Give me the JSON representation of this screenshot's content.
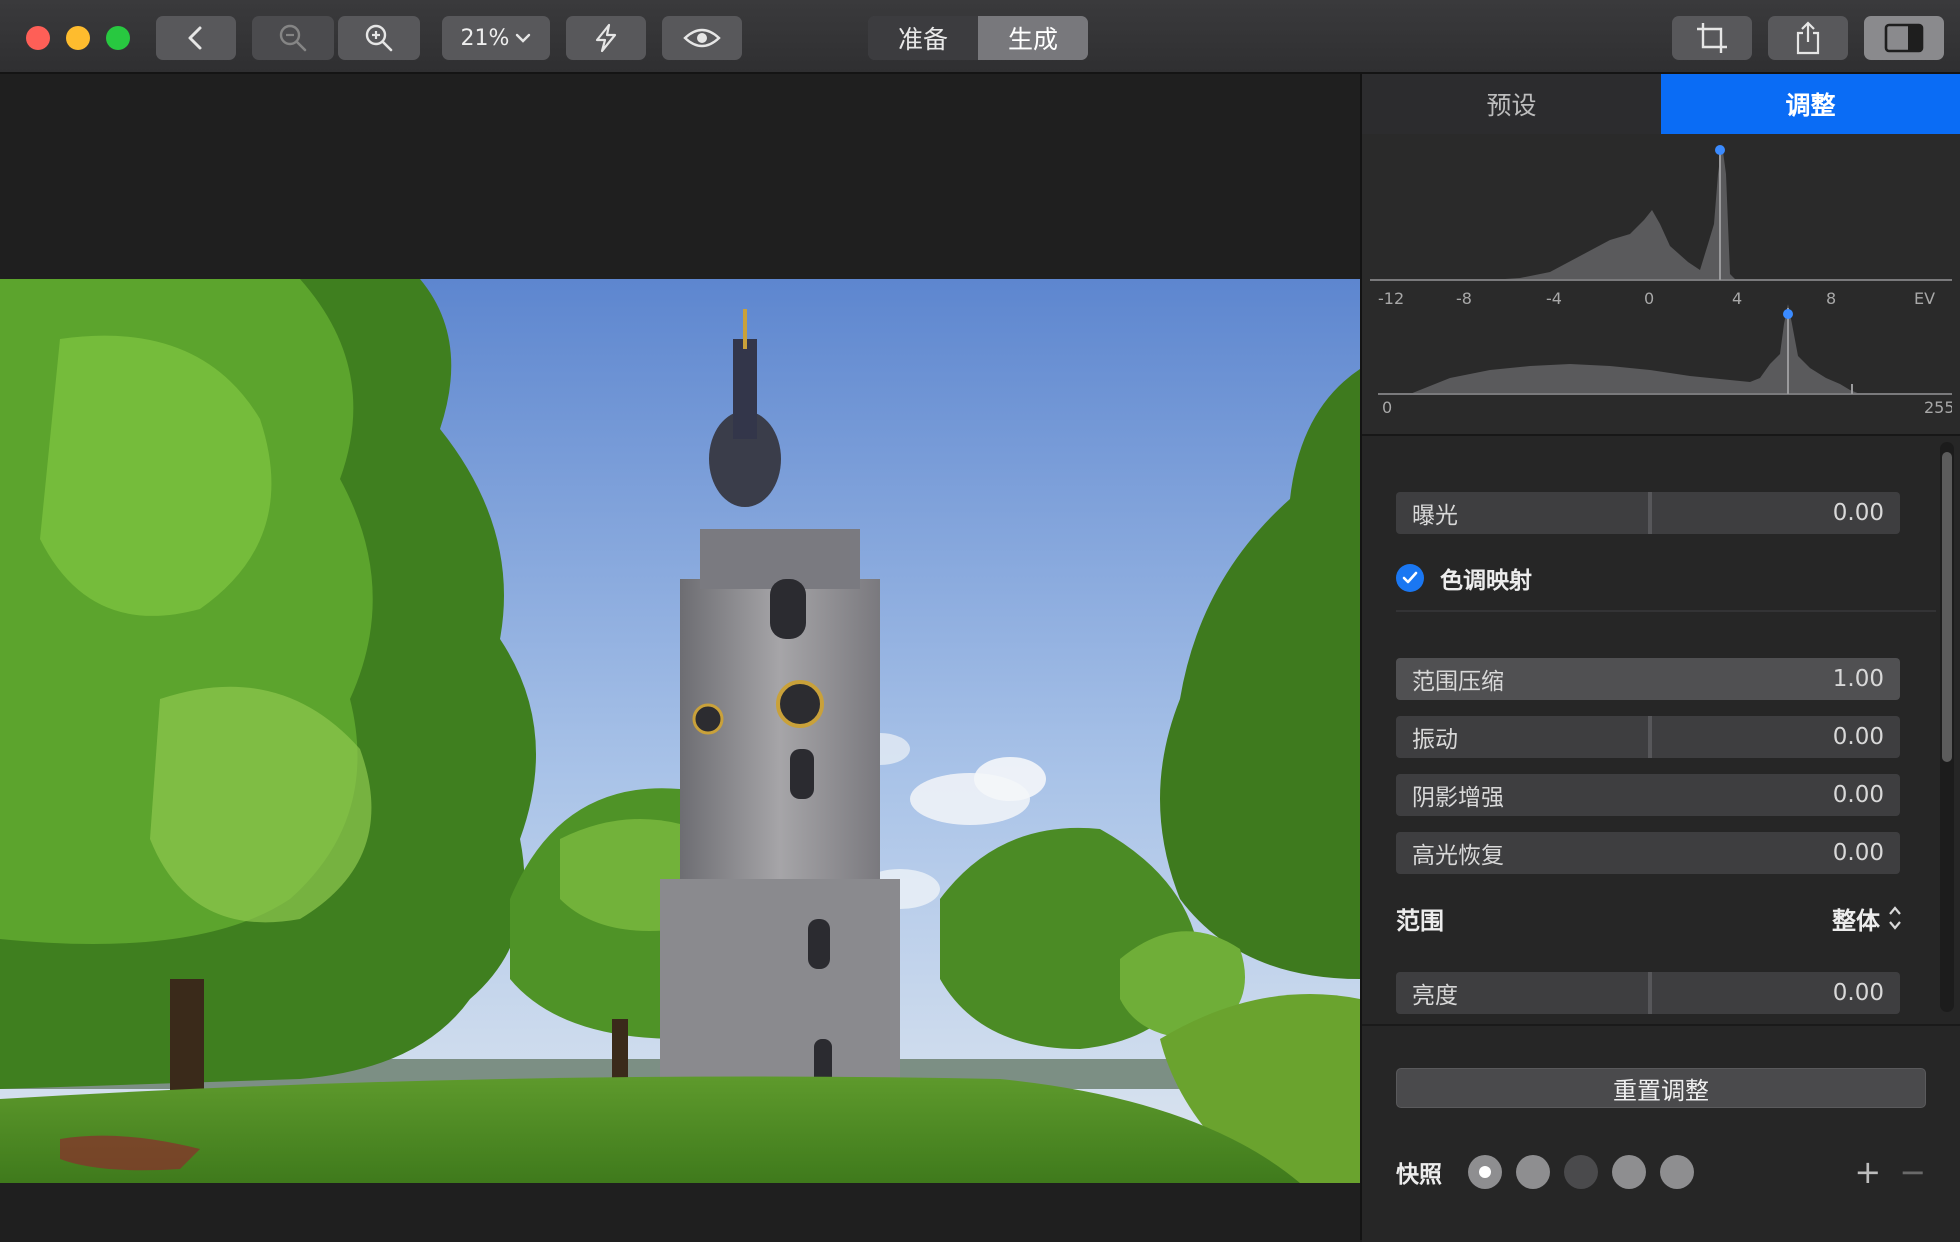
{
  "window": {
    "traffic_lights": {
      "close": "#fe5f57",
      "minimize": "#febc2e",
      "maximize": "#28c840"
    }
  },
  "toolbar": {
    "zoom_level": "21%",
    "mode_prepare": "准备",
    "mode_generate": "生成",
    "icons": [
      "back-icon",
      "zoom-out-icon",
      "zoom-in-icon",
      "lightning-icon",
      "eye-icon",
      "crop-icon",
      "share-icon",
      "sidebar-icon"
    ]
  },
  "sidebar": {
    "tabs": [
      {
        "label": "预设",
        "active": false
      },
      {
        "label": "调整",
        "active": true
      }
    ],
    "accent_color": "#0a6cf5",
    "histogram_ev": {
      "ticks": [
        "-12",
        "-8",
        "-4",
        "0",
        "4",
        "8",
        "EV"
      ]
    },
    "histogram_rgb": {
      "min_label": "0",
      "max_label": "255"
    },
    "exposure": {
      "label": "曝光",
      "value": "0.00"
    },
    "tone_mapping": {
      "title": "色调映射",
      "enabled": true,
      "sliders": [
        {
          "label": "范围压缩",
          "value": "1.00"
        },
        {
          "label": "振动",
          "value": "0.00"
        },
        {
          "label": "阴影增强",
          "value": "0.00"
        },
        {
          "label": "高光恢复",
          "value": "0.00"
        }
      ]
    },
    "range": {
      "label": "范围",
      "value": "整体"
    },
    "brightness": {
      "label": "亮度",
      "value": "0.00"
    },
    "reset_button": "重置调整",
    "snapshots": {
      "label": "快照",
      "count": 5,
      "active_index": 0,
      "add": "+",
      "remove": "−"
    }
  }
}
